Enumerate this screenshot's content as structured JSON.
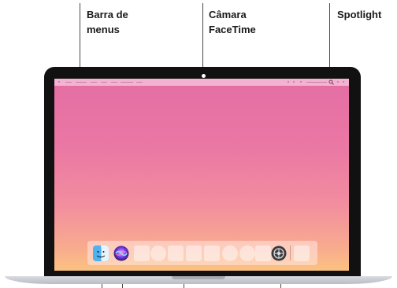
{
  "callouts": {
    "menu_bar_line1": "Barra de",
    "menu_bar_line2": "menus",
    "camera_line1": "Câmara",
    "camera_line2": "FaceTime",
    "spotlight": "Spotlight"
  },
  "dock": {
    "items": [
      "finder-icon",
      "siri-icon",
      "app-placeholder",
      "app-placeholder",
      "app-placeholder",
      "app-placeholder",
      "app-placeholder",
      "app-placeholder",
      "app-placeholder",
      "app-placeholder",
      "system-preferences-icon",
      "trash-placeholder"
    ]
  },
  "colors": {
    "wallpaper_top": "#e46ea4",
    "wallpaper_bottom": "#fbc280",
    "bezel": "#111111"
  }
}
